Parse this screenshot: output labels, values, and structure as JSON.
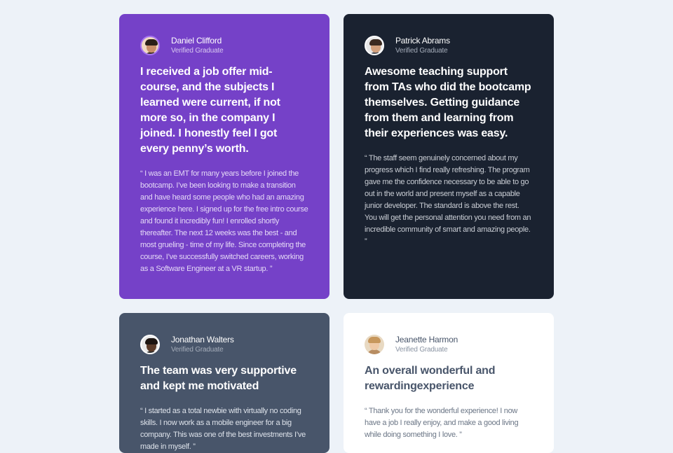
{
  "testimonials": [
    {
      "name": "Daniel Clifford",
      "role": "Verified Graduate",
      "headline": "I received a job offer mid-course, and the subjects I learned were current, if not more so, in the company I joined. I honestly feel I got every penny’s worth.",
      "quote": "“ I was an EMT for many years before I joined the bootcamp. I’ve been looking to make a transition and have heard some people who had an amazing experience here. I signed up for the free intro course and found it incredibly fun! I enrolled shortly thereafter. The next 12 weeks was the best - and most grueling - time of my life. Since completing the course, I’ve successfully switched careers, working as a Software Engineer at a VR startup. ”",
      "background": "#7541c8"
    },
    {
      "name": "Patrick Abrams",
      "role": "Verified Graduate",
      "headline": "Awesome teaching support from TAs who did the bootcamp themselves. Getting guidance from them and learning from their experiences was easy.",
      "quote": "“ The staff seem genuinely concerned about my progress which I find really refreshing. The program gave me the confidence necessary to be able to go out in the world and present myself as a capable junior developer. The standard is above the rest. You will get the personal attention you need from an incredible community of smart and amazing people. ”",
      "background": "#1a2230"
    },
    {
      "name": "Jonathan Walters",
      "role": "Verified Graduate",
      "headline": "The team was very supportive and kept me motivated",
      "quote": "“ I started as a total newbie with virtually no coding skills. I now work as a mobile engineer for a big company. This was one of the best investments I’ve made in myself. ”",
      "background": "#48556a"
    },
    {
      "name": "Jeanette Harmon",
      "role": "Verified Graduate",
      "headline": "An overall wonderful and rewardingexperience",
      "quote": "“ Thank you for the wonderful experience! I now have a job I really enjoy, and make a good living while doing something I love. ”",
      "background": "#ffffff"
    }
  ]
}
